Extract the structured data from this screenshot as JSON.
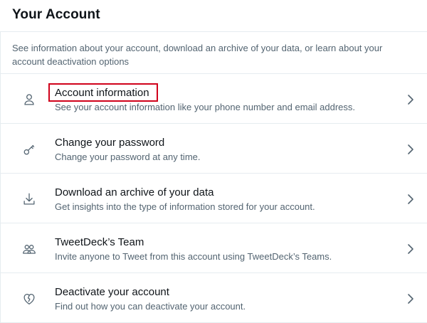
{
  "header": {
    "title": "Your Account"
  },
  "intro": {
    "text": "See information about your account, download an archive of your data, or learn about your account deactivation options"
  },
  "items": [
    {
      "title": "Account information",
      "description": "See your account information like your phone number and email address.",
      "icon": "person-icon",
      "highlighted": true
    },
    {
      "title": "Change your password",
      "description": "Change your password at any time.",
      "icon": "key-icon"
    },
    {
      "title": "Download an archive of your data",
      "description": "Get insights into the type of information stored for your account.",
      "icon": "download-icon"
    },
    {
      "title": "TweetDeck’s Team",
      "description": "Invite anyone to Tweet from this account using TweetDeck’s Teams.",
      "icon": "people-icon"
    },
    {
      "title": "Deactivate your account",
      "description": "Find out how you can deactivate your account.",
      "icon": "broken-heart-icon"
    }
  ],
  "colors": {
    "highlight_border": "#d0021b",
    "secondary_text": "#536471",
    "divider": "#e6ecf0"
  }
}
